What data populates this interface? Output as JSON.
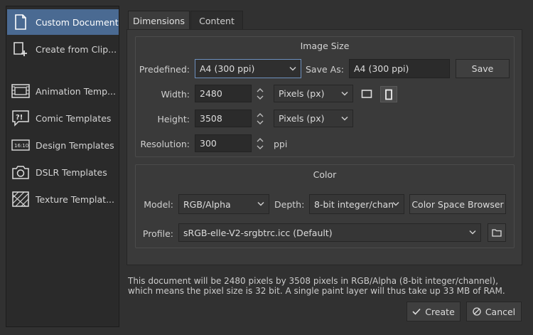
{
  "sidebar": {
    "items": [
      {
        "label": "Custom Document",
        "icon": "document-icon",
        "active": true
      },
      {
        "label": "Create from Clip...",
        "icon": "clipboard-icon",
        "active": false
      },
      {
        "label": "Animation Temp...",
        "icon": "animation-icon",
        "active": false
      },
      {
        "label": "Comic Templates",
        "icon": "comic-icon",
        "active": false
      },
      {
        "label": "Design Templates",
        "icon": "design-icon",
        "active": false
      },
      {
        "label": "DSLR Templates",
        "icon": "camera-icon",
        "active": false
      },
      {
        "label": "Texture Templat...",
        "icon": "texture-icon",
        "active": false
      }
    ]
  },
  "tabs": [
    {
      "label": "Dimensions",
      "active": true
    },
    {
      "label": "Content",
      "active": false
    }
  ],
  "image_size": {
    "title": "Image Size",
    "predefined_label": "Predefined:",
    "predefined_value": "A4 (300 ppi)",
    "save_as_label": "Save As:",
    "save_as_value": "A4 (300 ppi)",
    "save_button": "Save",
    "width_label": "Width:",
    "width_value": "2480",
    "width_unit": "Pixels (px)",
    "height_label": "Height:",
    "height_value": "3508",
    "height_unit": "Pixels (px)",
    "resolution_label": "Resolution:",
    "resolution_value": "300",
    "resolution_unit": "ppi"
  },
  "color": {
    "title": "Color",
    "model_label": "Model:",
    "model_value": "RGB/Alpha",
    "depth_label": "Depth:",
    "depth_value": "8-bit integer/chan",
    "color_space_button": "Color Space Browser",
    "profile_label": "Profile:",
    "profile_value": "sRGB-elle-V2-srgbtrc.icc (Default)"
  },
  "info_text_line1": "This document will be 2480 pixels by 3508 pixels in RGB/Alpha (8-bit integer/channel),",
  "info_text_line2": "which means the pixel size is 32 bit. A single paint layer will thus take up 33 MB of RAM.",
  "buttons": {
    "create": "Create",
    "cancel": "Cancel"
  }
}
